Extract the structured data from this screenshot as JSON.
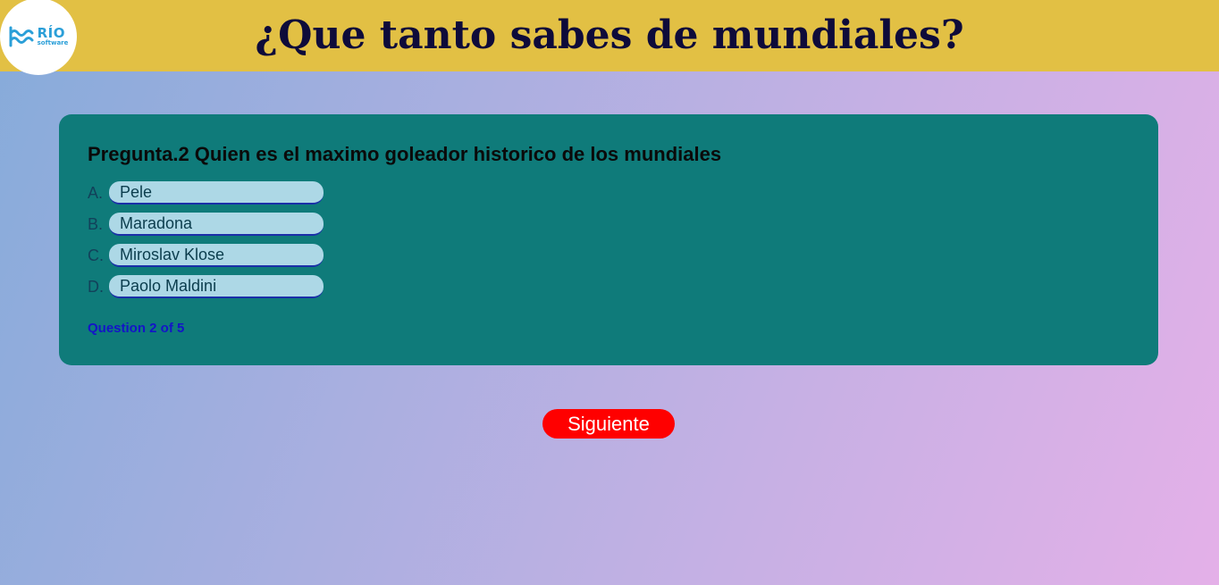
{
  "app": {
    "title": "¿Que tanto sabes de mundiales?",
    "logo": {
      "name": "RÍO",
      "sub": "software",
      "icon": "waves-icon",
      "color": "#2b9fd8"
    }
  },
  "quiz": {
    "question": "Pregunta.2 Quien es el maximo goleador historico de los mundiales",
    "options": [
      {
        "letter": "A.",
        "label": "Pele"
      },
      {
        "letter": "B.",
        "label": "Maradona"
      },
      {
        "letter": "C.",
        "label": "Miroslav Klose"
      },
      {
        "letter": "D.",
        "label": "Paolo Maldini"
      }
    ],
    "progress": "Question 2 of 5"
  },
  "actions": {
    "next_label": "Siguiente"
  },
  "colors": {
    "header": "#e2c044",
    "card": "#0f7b7a",
    "option": "#add8e6",
    "next_button": "#ff0000"
  }
}
